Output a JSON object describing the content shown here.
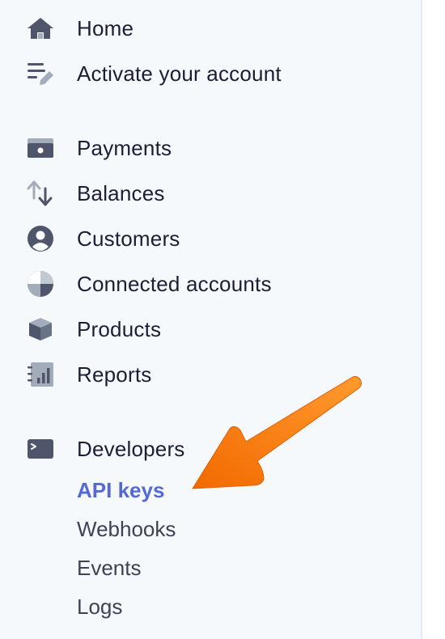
{
  "sidebar": {
    "primary": [
      {
        "label": "Home",
        "icon": "home-icon"
      },
      {
        "label": "Activate your account",
        "icon": "activate-icon"
      }
    ],
    "main": [
      {
        "label": "Payments",
        "icon": "payments-icon"
      },
      {
        "label": "Balances",
        "icon": "balances-icon"
      },
      {
        "label": "Customers",
        "icon": "customers-icon"
      },
      {
        "label": "Connected accounts",
        "icon": "connected-accounts-icon"
      },
      {
        "label": "Products",
        "icon": "products-icon"
      },
      {
        "label": "Reports",
        "icon": "reports-icon"
      }
    ],
    "developers": {
      "label": "Developers",
      "icon": "terminal-icon",
      "subitems": [
        {
          "label": "API keys",
          "active": true
        },
        {
          "label": "Webhooks",
          "active": false
        },
        {
          "label": "Events",
          "active": false
        },
        {
          "label": "Logs",
          "active": false
        }
      ]
    }
  },
  "colors": {
    "background": "#f6f9fc",
    "text": "#1a1f36",
    "icon": "#4f566b",
    "active": "#5469d4",
    "annotation_arrow": "#f57c00"
  }
}
